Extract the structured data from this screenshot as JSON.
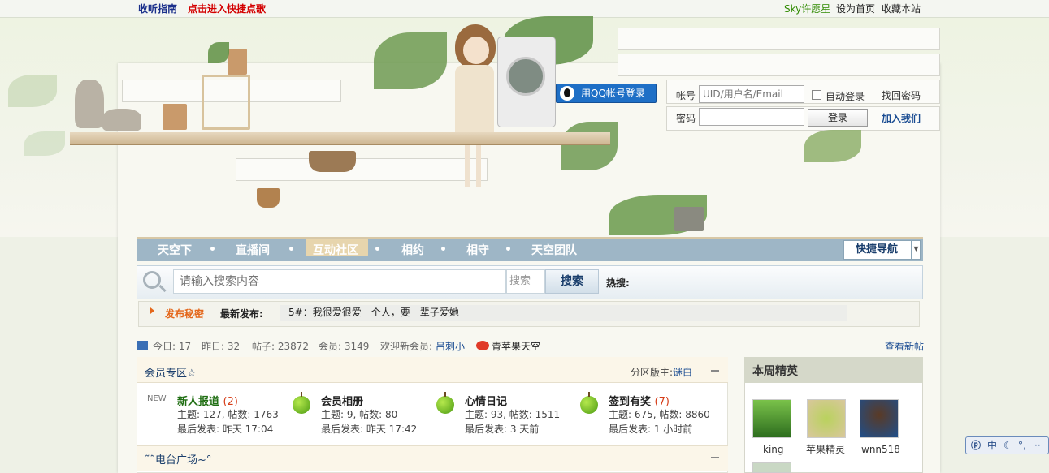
{
  "topbar": {
    "guide": "收听指南",
    "quick_song": "点击进入快捷点歌",
    "sky_wish": "Sky许愿星",
    "set_home": "设为首页",
    "bookmark": "收藏本站"
  },
  "login": {
    "qq_button": "用QQ帐号登录",
    "account_label": "帐号",
    "account_placeholder": "UID/用户名/Email",
    "auto_login": "自动登录",
    "find_password": "找回密码",
    "password_label": "密码",
    "login_button": "登录",
    "join": "加入我们"
  },
  "nav": {
    "items": [
      "天空下",
      "直播间",
      "互动社区",
      "相约",
      "相守",
      "天空团队"
    ],
    "quick_nav": "快捷导航"
  },
  "search": {
    "placeholder": "请输入搜索内容",
    "type": "搜索",
    "button": "搜索",
    "hot_label": "热搜:"
  },
  "announce": {
    "secret": "发布秘密",
    "label": "最新发布:",
    "text": "5#：我很爱很爱一个人，要一辈子爱她"
  },
  "stats": {
    "today": "今日: 17",
    "yesterday": "昨日: 32",
    "posts": "帖子: 23872",
    "members": "会员: 3149",
    "welcome": "欢迎新会员:",
    "new_member": "吕刺小",
    "weibo": "青苹果天空",
    "new_posts": "查看新帖"
  },
  "section": {
    "title": "会员专区☆",
    "moderator_label": "分区版主:",
    "moderator": "谜白",
    "new_badge": "NEW",
    "forums": [
      {
        "name": "新人报道",
        "count": "(2)",
        "stats": "主题: 127, 帖数: 1763",
        "last": "最后发表: 昨天 17:04"
      },
      {
        "name": "会员相册",
        "count": "",
        "stats": "主题: 9, 帖数: 80",
        "last": "最后发表: 昨天 17:42"
      },
      {
        "name": "心情日记",
        "count": "",
        "stats": "主题: 93, 帖数: 1511",
        "last": "最后发表: 3 天前"
      },
      {
        "name": "签到有奖",
        "count": "(7)",
        "stats": "主题: 675, 帖数: 8860",
        "last": "最后发表: 1 小时前"
      }
    ],
    "next_title": "˜˜电台广场~°"
  },
  "weekly": {
    "title": "本周精英",
    "members": [
      "king",
      "苹果精灵",
      "wnn518"
    ]
  },
  "ime": {
    "mode": "中"
  },
  "colors": {
    "nav": "#9eb6c6",
    "link": "#1a4c92",
    "accent_red": "#d30000"
  }
}
